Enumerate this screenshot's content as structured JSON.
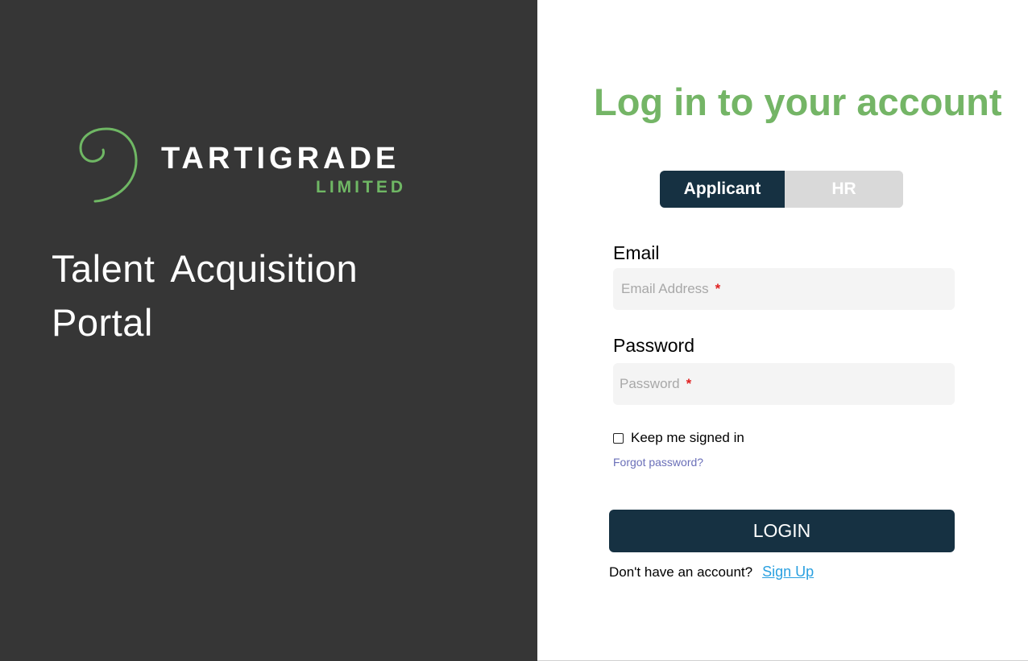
{
  "brand": {
    "name": "TARTIGRADE",
    "subname": "LIMITED",
    "portal_title": "Talent Acquisition Portal",
    "accent_color": "#6fb764",
    "panel_color": "#363636"
  },
  "login": {
    "heading": "Log in to your account",
    "roles": {
      "applicant": "Applicant",
      "hr": "HR",
      "selected": "Applicant"
    },
    "email": {
      "label": "Email",
      "placeholder": "Email Address",
      "required_mark": "*"
    },
    "password": {
      "label": "Password",
      "placeholder": "Password",
      "required_mark": "*"
    },
    "keep_signed_in": {
      "label": "Keep me signed in",
      "checked": false
    },
    "forgot_password": "Forgot password?",
    "login_button": "LOGIN",
    "signup_prompt": "Don't have an account?",
    "signup_link": "Sign Up",
    "primary_color": "#163142",
    "heading_color": "#74b566",
    "link_color": "#2aa0e0"
  }
}
